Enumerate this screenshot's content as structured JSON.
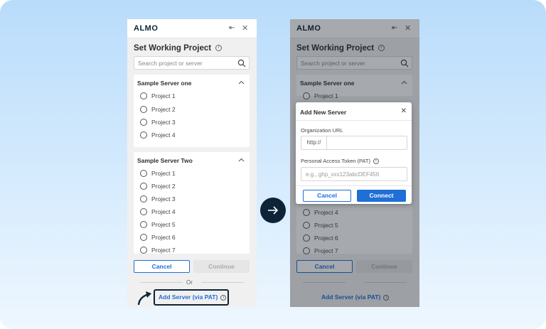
{
  "colors": {
    "accent": "#1f6fd6",
    "navy": "#0d2438",
    "background": "#cfe6fc"
  },
  "header": {
    "logo": "ALMO",
    "pin_icon": "pin-icon",
    "close_icon": "close-icon"
  },
  "page_title": "Set Working Project",
  "search": {
    "placeholder": "Search project or server"
  },
  "servers": [
    {
      "name": "Sample Server one",
      "projects": [
        "Project 1",
        "Project 2",
        "Project 3",
        "Project 4"
      ]
    },
    {
      "name": "Sample Server Two",
      "projects": [
        "Project 1",
        "Project 2",
        "Project 3",
        "Project 4",
        "Project 5",
        "Project 6",
        "Project 7"
      ]
    }
  ],
  "footer": {
    "cancel": "Cancel",
    "continue": "Continue",
    "or": "Or",
    "add_server": "Add Server (via PAT)"
  },
  "modal": {
    "title": "Add New Server",
    "org_url_label": "Organization URL",
    "url_prefix": "http://",
    "pat_label": "Personal Access Token (PAT)",
    "pat_placeholder": "e.g., ghp_xxx123abcDEF456",
    "cancel": "Cancel",
    "connect": "Connect"
  }
}
